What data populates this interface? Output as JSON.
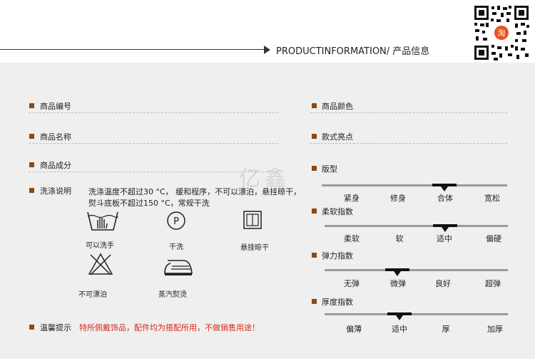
{
  "header": {
    "title": "PRODUCTINFORMATION/ 产品信息"
  },
  "left": {
    "code_label": "商品编号",
    "name_label": "商品名称",
    "composition_label": "商品成分",
    "wash_label": "洗涤说明",
    "wash_text_line1": "洗涤温度不超过30 °C， 缓和程序，不可以漂泊，悬挂晾干，",
    "wash_text_line2": "熨斗底板不超过150 °C，常规干洗",
    "icons": {
      "hand_wash": "可以洗手",
      "dry_clean": "干洗",
      "hang_dry": "悬挂晾干",
      "no_bleach": "不可漂泊",
      "steam_iron": "蒸汽熨烫"
    },
    "notice_label": "温馨提示",
    "notice_text": "特所佩戴饰品，配件均为搭配所用，不做销售用途！"
  },
  "right": {
    "color_label": "商品颜色",
    "style_label": "款式亮点",
    "fit": {
      "label": "版型",
      "options": [
        "紧身",
        "修身",
        "合体",
        "宽松"
      ],
      "selected": 2
    },
    "softness": {
      "label": "柔软指数",
      "options": [
        "柔软",
        "软",
        "适中",
        "偏硬"
      ],
      "selected": 2
    },
    "elasticity": {
      "label": "弹力指数",
      "options": [
        "无弹",
        "微弹",
        "良好",
        "超弹"
      ],
      "selected": 1
    },
    "thickness": {
      "label": "厚度指数",
      "options": [
        "偏薄",
        "适中",
        "厚",
        "加厚"
      ],
      "selected": 1
    }
  },
  "watermark": "亿鑫",
  "qr_badge": "淘",
  "colors": {
    "bullet": "#8a4a16",
    "panel": "#efefef",
    "notice_red": "#d62a1c"
  }
}
